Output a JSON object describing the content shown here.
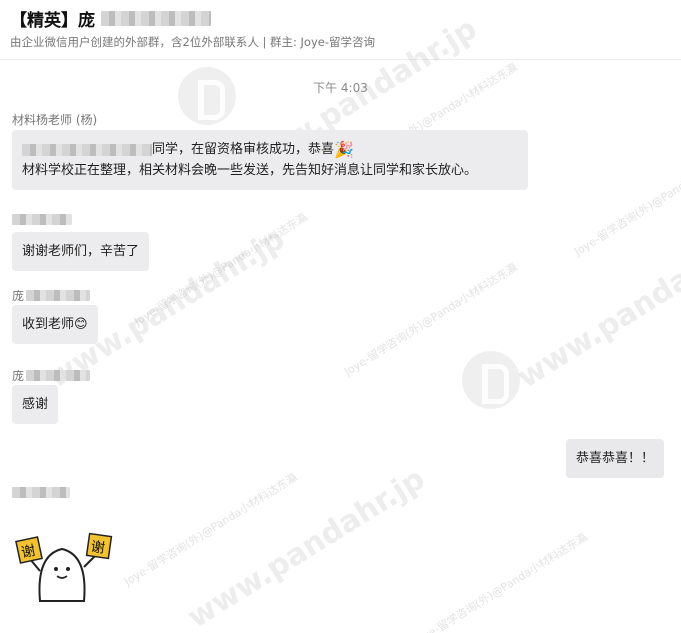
{
  "header": {
    "title": "【精英】庞",
    "subtitle": "由企业微信用户创建的外部群，含2位外部联系人 | 群主: Joye-留学咨询"
  },
  "chat": {
    "time_divider": "下午 4:03",
    "messages": [
      {
        "sender": "材料杨老师 (杨)",
        "line1_suffix": "同学，在留资格审核成功，恭喜",
        "line1_emoji": "🎉",
        "line2": "材料学校正在整理，相关材料会晚一些发送，先告知好消息让同学和家长放心。"
      },
      {
        "sender": "",
        "text": "谢谢老师们，辛苦了"
      },
      {
        "sender": "庞",
        "text": "收到老师",
        "emoji": "😊"
      },
      {
        "sender": "庞",
        "text": "感谢"
      },
      {
        "sender": "",
        "text": "恭喜恭喜！！",
        "side": "right"
      },
      {
        "sender": "",
        "sticker": "thanks-sticker",
        "sticker_text_left": "谢",
        "sticker_text_right": "谢"
      }
    ]
  },
  "watermark": {
    "site": "www.pandahr.jp",
    "note": "Joye-留学咨询(外)@Panda小材料达东瀛"
  }
}
